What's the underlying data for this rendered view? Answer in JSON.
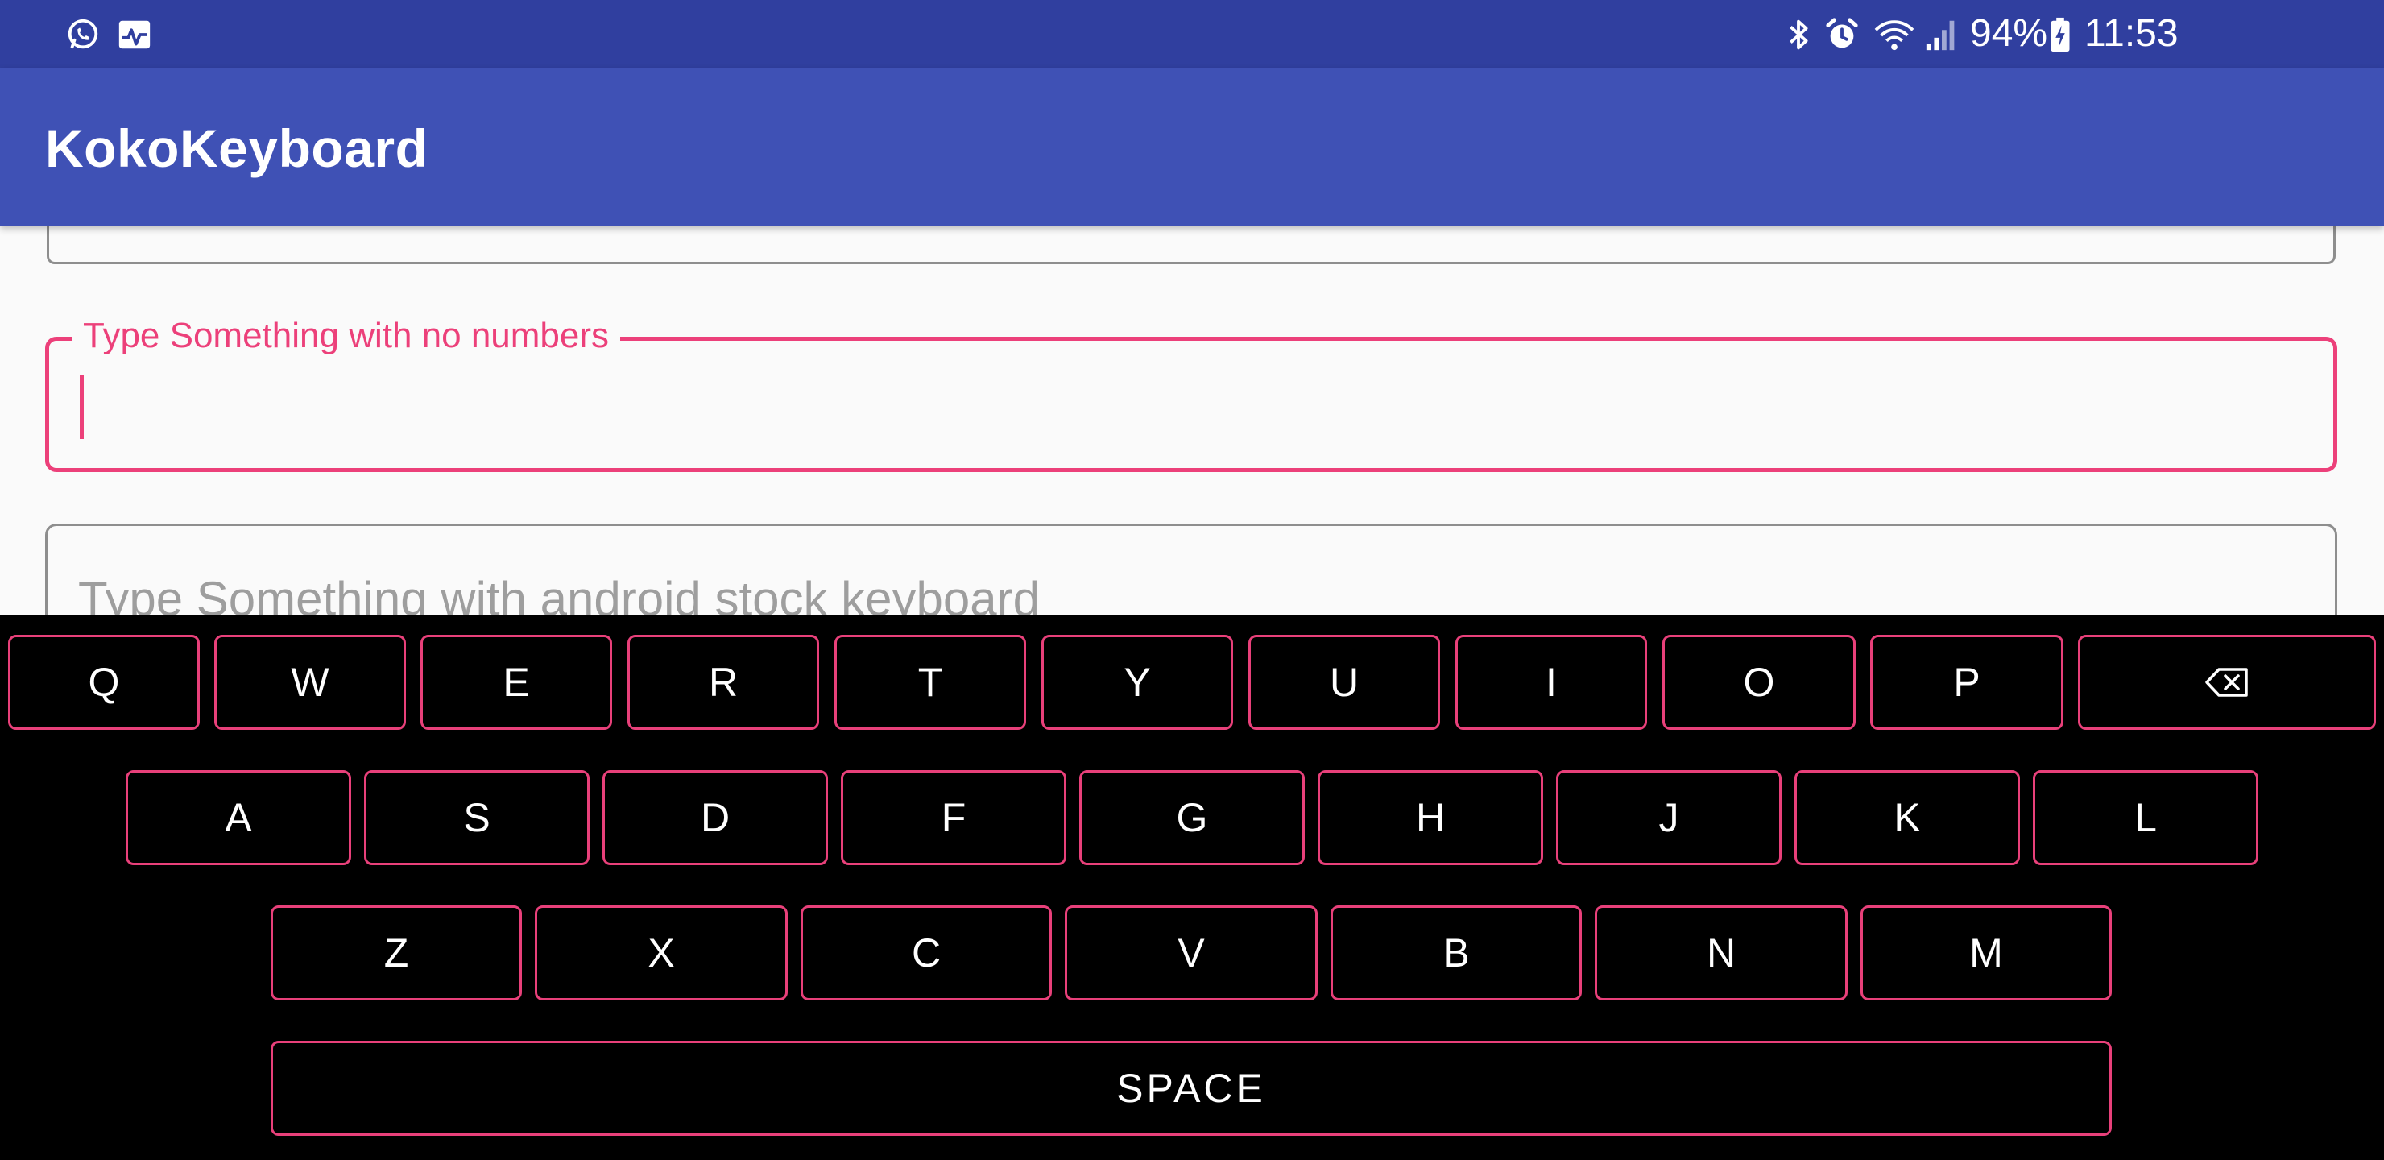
{
  "status_bar": {
    "notification_icons": [
      "whatsapp-icon",
      "activity-monitor-icon"
    ],
    "system_icons": [
      "bluetooth-icon",
      "alarm-icon",
      "wifi-icon",
      "signal-icon",
      "battery-charging-icon"
    ],
    "battery": "94%",
    "time": "11:53"
  },
  "app_bar": {
    "title": "KokoKeyboard"
  },
  "form": {
    "active_field": {
      "label": "Type Something with no numbers",
      "value": ""
    },
    "next_field": {
      "placeholder": "Type Something with android stock keyboard"
    }
  },
  "keyboard": {
    "row1": [
      "Q",
      "W",
      "E",
      "R",
      "T",
      "Y",
      "U",
      "I",
      "O",
      "P"
    ],
    "row2": [
      "A",
      "S",
      "D",
      "F",
      "G",
      "H",
      "J",
      "K",
      "L"
    ],
    "row3": [
      "Z",
      "X",
      "C",
      "V",
      "B",
      "N",
      "M"
    ],
    "backspace_icon": "backspace-icon",
    "space_label": "SPACE"
  },
  "colors": {
    "status_bar": "#303f9f",
    "app_bar": "#3f51b5",
    "accent": "#ec407a",
    "keyboard_bg": "#000000",
    "key_border": "#e8407a"
  }
}
